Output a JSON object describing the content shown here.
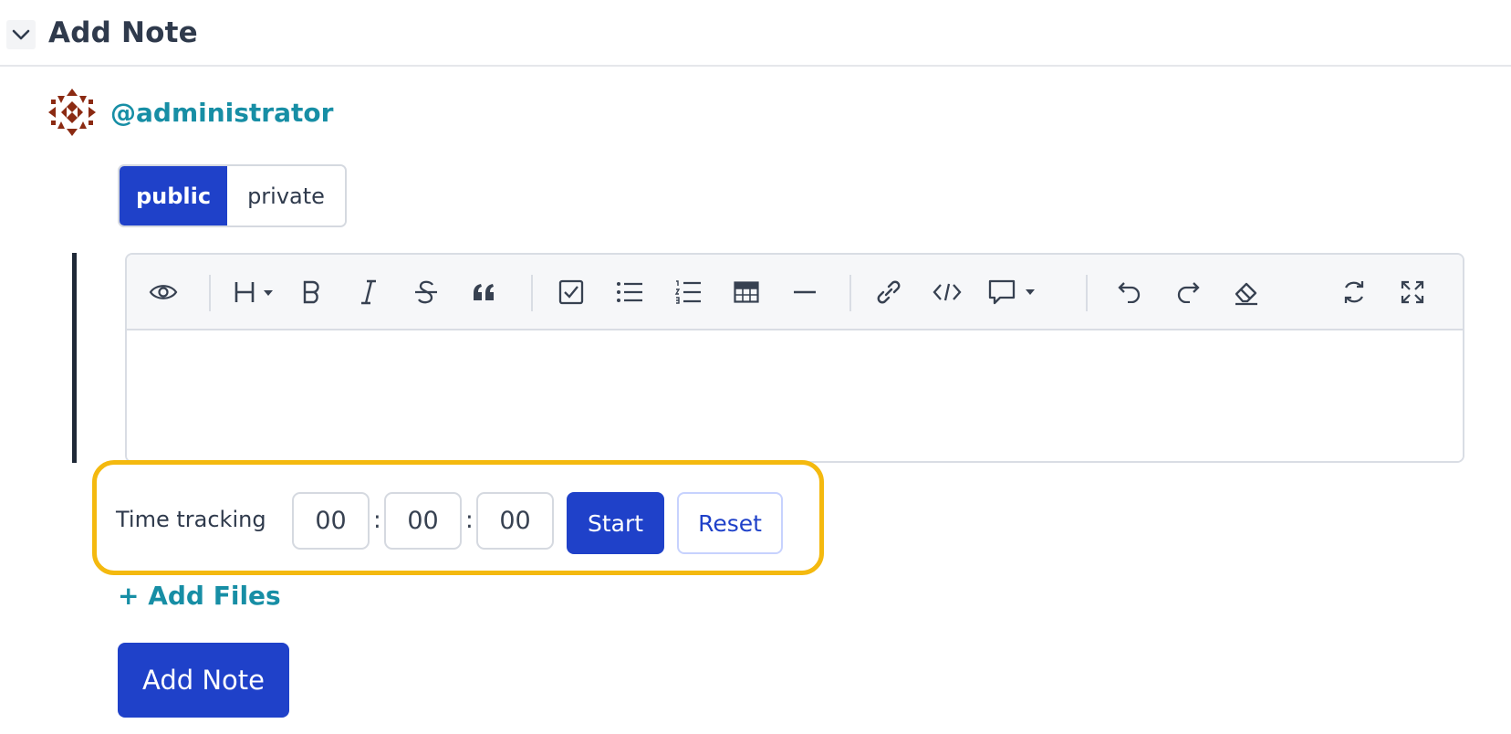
{
  "header": {
    "title": "Add Note",
    "collapse_icon": "chevron-down-icon"
  },
  "author": {
    "username": "@administrator",
    "avatar_color": "#8b2a12"
  },
  "visibility": {
    "options": [
      "public",
      "private"
    ],
    "selected": "public"
  },
  "editor": {
    "toolbar_icons": [
      "preview-icon",
      "heading-icon",
      "bold-icon",
      "italic-icon",
      "strikethrough-icon",
      "quote-icon",
      "task-list-icon",
      "bullet-list-icon",
      "numbered-list-icon",
      "table-icon",
      "horizontal-rule-icon",
      "link-icon",
      "code-icon",
      "comment-icon",
      "undo-icon",
      "redo-icon",
      "clear-format-icon",
      "sync-icon",
      "fullscreen-icon"
    ],
    "content": ""
  },
  "time_tracking": {
    "label": "Time tracking",
    "hours": "00",
    "minutes": "00",
    "seconds": "00",
    "start_label": "Start",
    "reset_label": "Reset"
  },
  "add_files_label": "+ Add Files",
  "submit_label": "Add Note",
  "colors": {
    "primary": "#1f41c9",
    "link": "#178ea5",
    "highlight": "#f4b90f",
    "text": "#2f3a4c"
  }
}
